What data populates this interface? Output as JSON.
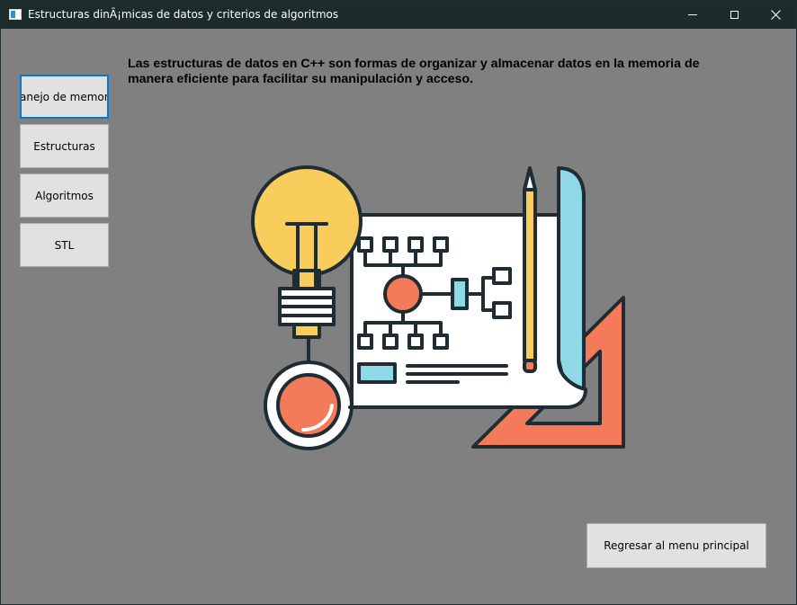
{
  "window": {
    "title": "Estructuras dinÃ¡micas de datos y criterios de algoritmos"
  },
  "sidebar": {
    "items": [
      {
        "label": "Manejo de memoria"
      },
      {
        "label": "Estructuras"
      },
      {
        "label": "Algoritmos"
      },
      {
        "label": "STL"
      }
    ]
  },
  "main": {
    "description": "Las estructuras de datos en C++ son formas de organizar y almacenar datos en la memoria de manera eficiente para facilitar su manipulación y acceso.",
    "illustration": "data-structures-illustration"
  },
  "footer": {
    "back_label": "Regresar al menu principal"
  },
  "colors": {
    "background": "#808080",
    "titlebar": "#1d2b2b",
    "button": "#e1e1e1",
    "focus": "#0078d7",
    "bulb": "#f9cd5b",
    "coral": "#f47b5a",
    "teal": "#8fd8e8",
    "outline": "#1f2c33"
  }
}
